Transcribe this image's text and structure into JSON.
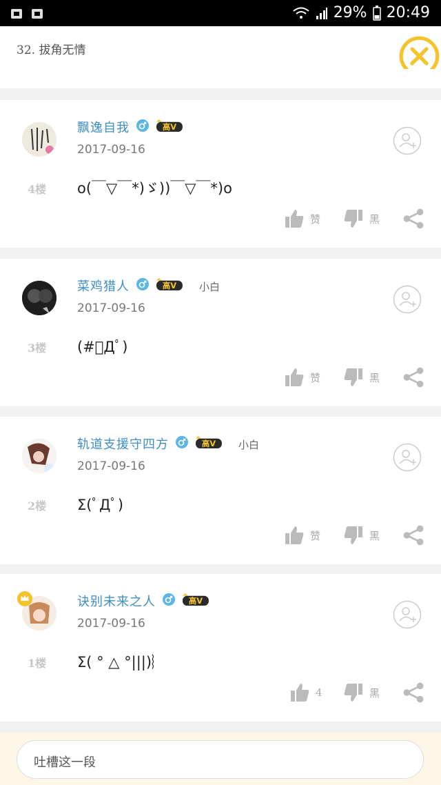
{
  "status_bar": {
    "battery": "29%",
    "time": "20:49"
  },
  "header": {
    "title": "32. 拔角无情"
  },
  "labels": {
    "like": "赞",
    "dislike": "黑",
    "vip_badge": "高V"
  },
  "comments": [
    {
      "username": "飘逸自我",
      "level": "",
      "date": "2017-09-16",
      "floor": "4楼",
      "content": "o(￣▽￣*)ゞ))￣▽￣*)o",
      "like_label": "赞",
      "dislike_label": "黑"
    },
    {
      "username": "菜鸡猎人",
      "level": "小白",
      "date": "2017-09-16",
      "floor": "3楼",
      "content": "(#ﾟДﾟ)",
      "like_label": "赞",
      "dislike_label": "黑"
    },
    {
      "username": "轨道支援守四方",
      "level": "小白",
      "date": "2017-09-16",
      "floor": "2楼",
      "content": "Σ(ﾟДﾟ)",
      "like_label": "赞",
      "dislike_label": "黑"
    },
    {
      "username": "诀别未来之人",
      "level": "",
      "date": "2017-09-16",
      "floor": "1楼",
      "content": "Σ( ° △ °|||)︴",
      "like_label": "4",
      "dislike_label": "黑"
    }
  ],
  "comment_input": {
    "placeholder": "吐槽这一段"
  },
  "colors": {
    "username": "#3d8ec2",
    "accent_yellow": "#f5c32c",
    "verified_blue": "#5bb6e6",
    "action_gray": "#aaaaaa"
  }
}
